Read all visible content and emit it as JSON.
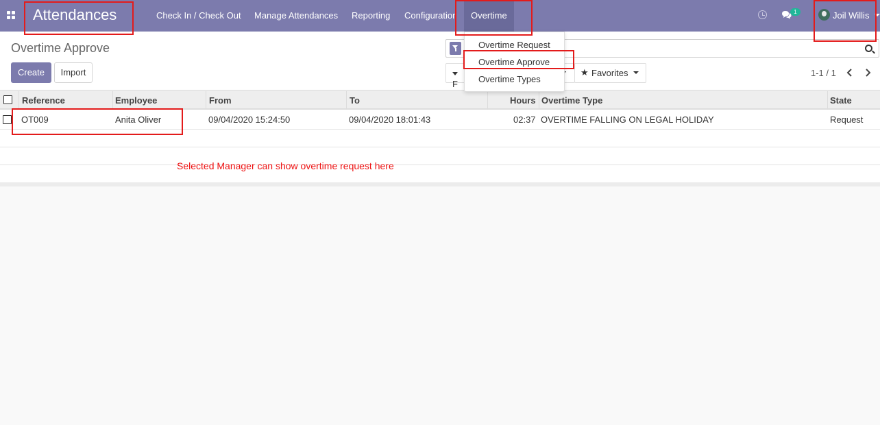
{
  "navbar": {
    "app_name": "Attendances",
    "menu": [
      "Check In / Check Out",
      "Manage Attendances",
      "Reporting",
      "Configuration",
      "Overtime"
    ],
    "active_menu": "Overtime",
    "messages_badge": "1",
    "user_name": "Joil Willis"
  },
  "overtime_dropdown": {
    "items": [
      "Overtime Request",
      "Overtime Approve",
      "Overtime Types"
    ]
  },
  "control_panel": {
    "title": "Overtime Approve",
    "create_label": "Create",
    "import_label": "Import",
    "filters_label_partial": "F",
    "favorites_label": "Favorites",
    "pager": "1-1 / 1"
  },
  "table": {
    "columns": [
      "Reference",
      "Employee",
      "From",
      "To",
      "Hours",
      "Overtime Type",
      "State"
    ],
    "rows": [
      {
        "reference": "OT009",
        "employee": "Anita Oliver",
        "from": "09/04/2020 15:24:50",
        "to": "09/04/2020 18:01:43",
        "hours": "02:37",
        "overtime_type": "OVERTIME FALLING ON LEGAL HOLIDAY",
        "state": "Request"
      }
    ]
  },
  "annotation": {
    "note": "Selected Manager can show overtime request here",
    "color": "#ee1111"
  },
  "colors": {
    "brand": "#7c7bad",
    "badge": "#21b799"
  }
}
